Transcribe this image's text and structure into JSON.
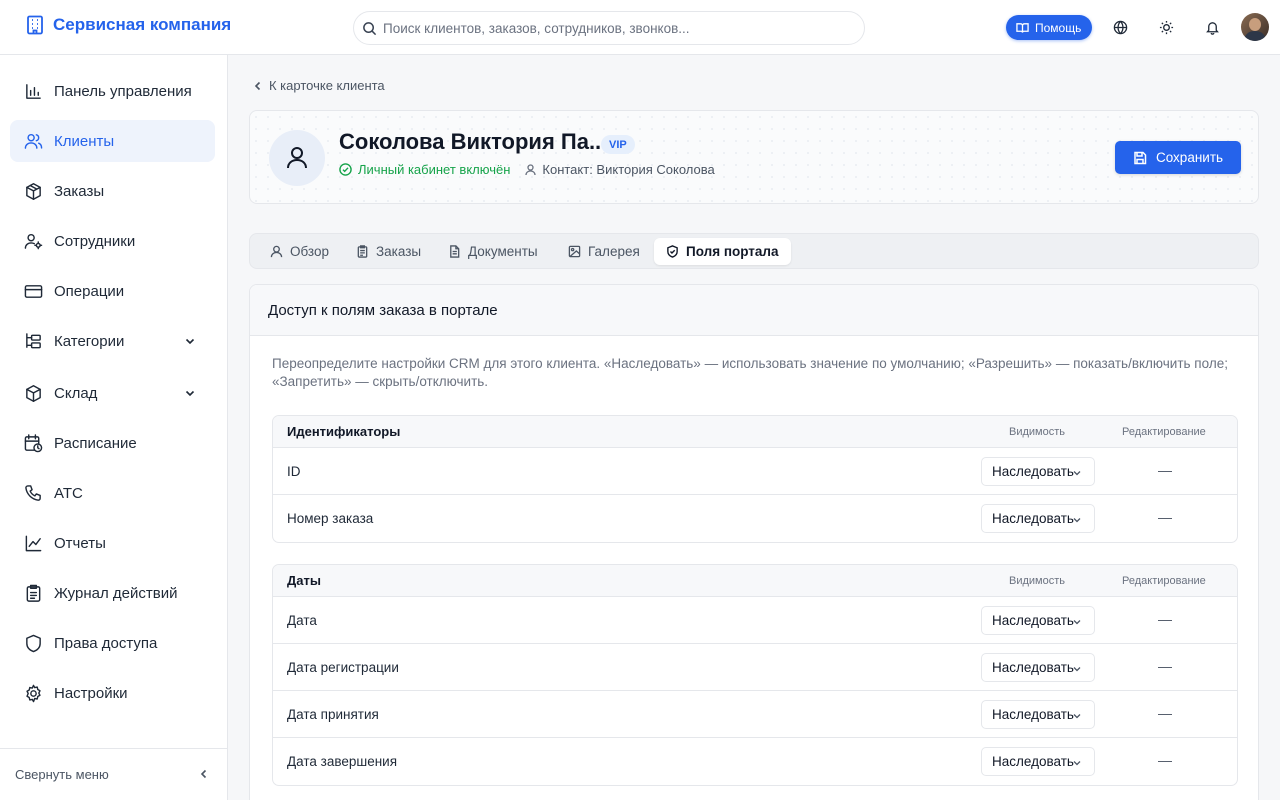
{
  "header": {
    "brand": "Сервисная компания",
    "search_placeholder": "Поиск клиентов, заказов, сотрудников, звонков...",
    "help_label": "Помощь",
    "icons": [
      "globe-icon",
      "sun-icon",
      "bell-icon"
    ],
    "accent_color": "#2563eb"
  },
  "sidebar": {
    "items": [
      {
        "label": "Панель управления",
        "icon": "bar-chart-icon"
      },
      {
        "label": "Клиенты",
        "icon": "users-icon",
        "active": true
      },
      {
        "label": "Заказы",
        "icon": "package-icon"
      },
      {
        "label": "Сотрудники",
        "icon": "user-cog-icon"
      },
      {
        "label": "Операции",
        "icon": "credit-card-icon"
      },
      {
        "label": "Категории",
        "icon": "tree-icon",
        "expandable": true
      },
      {
        "label": "Склад",
        "icon": "box-icon",
        "expandable": true
      },
      {
        "label": "Расписание",
        "icon": "calendar-clock-icon"
      },
      {
        "label": "АТС",
        "icon": "phone-icon"
      },
      {
        "label": "Отчеты",
        "icon": "line-chart-icon"
      },
      {
        "label": "Журнал действий",
        "icon": "clipboard-icon"
      },
      {
        "label": "Права доступа",
        "icon": "shield-icon"
      },
      {
        "label": "Настройки",
        "icon": "gear-icon"
      }
    ],
    "collapse_label": "Свернуть меню"
  },
  "main": {
    "back_label": "К карточке клиента",
    "client": {
      "name": "Соколова Виктория Па...",
      "badge": "VIP",
      "portal_status": "Личный кабинет включён",
      "contact": "Контакт: Виктория Соколова"
    },
    "save_label": "Сохранить",
    "tabs": [
      {
        "label": "Обзор",
        "icon": "user-icon"
      },
      {
        "label": "Заказы",
        "icon": "clipboard-icon"
      },
      {
        "label": "Документы",
        "icon": "file-icon"
      },
      {
        "label": "Галерея",
        "icon": "image-icon"
      },
      {
        "label": "Поля портала",
        "icon": "shield-icon",
        "active": true
      }
    ],
    "panel": {
      "title": "Доступ к полям заказа в портале",
      "description": "Переопределите настройки CRM для этого клиента. «Наследовать» — использовать значение по умолчанию; «Разрешить» — показать/включить поле; «Запретить» — скрыть/отключить.",
      "columns": {
        "visibility": "Видимость",
        "editing": "Редактирование"
      },
      "groups": [
        {
          "title": "Идентификаторы",
          "rows": [
            {
              "label": "ID",
              "visibility": "Наследовать",
              "editing": "—"
            },
            {
              "label": "Номер заказа",
              "visibility": "Наследовать",
              "editing": "—"
            }
          ]
        },
        {
          "title": "Даты",
          "rows": [
            {
              "label": "Дата",
              "visibility": "Наследовать",
              "editing": "—"
            },
            {
              "label": "Дата регистрации",
              "visibility": "Наследовать",
              "editing": "—"
            },
            {
              "label": "Дата принятия",
              "visibility": "Наследовать",
              "editing": "—"
            },
            {
              "label": "Дата завершения",
              "visibility": "Наследовать",
              "editing": "—"
            }
          ]
        }
      ]
    }
  }
}
